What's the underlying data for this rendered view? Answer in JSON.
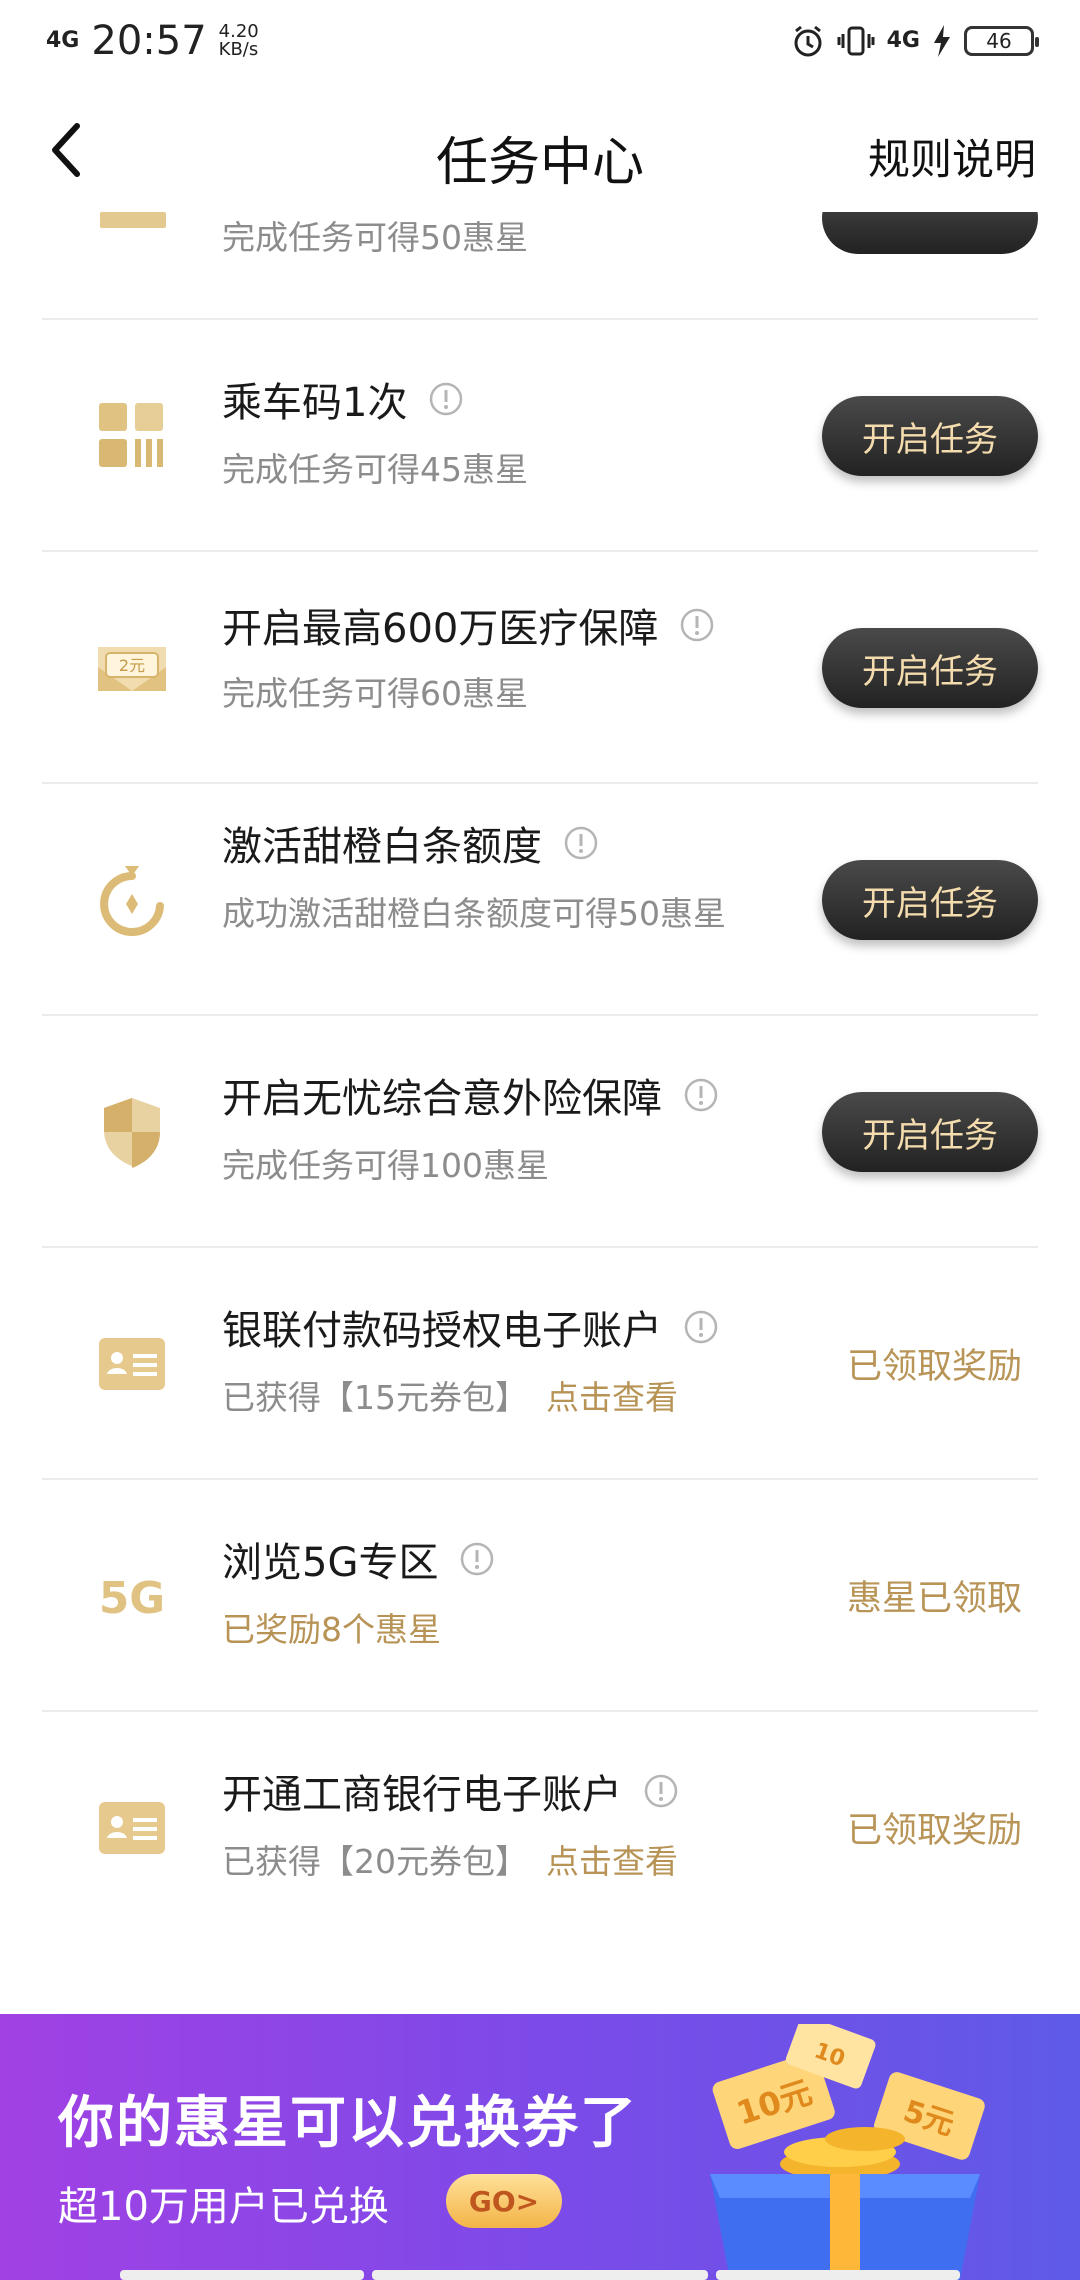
{
  "status_bar": {
    "network_left": "4G",
    "time": "20:57",
    "speed_value": "4.20",
    "speed_unit": "KB/s",
    "network_right": "4G",
    "battery": "46"
  },
  "header": {
    "title": "任务中心",
    "rules_label": "规则说明"
  },
  "partial_task": {
    "desc": "完成任务可得50惠星"
  },
  "tasks": [
    {
      "title": "乘车码1次",
      "desc": "完成任务可得45惠星",
      "action": "开启任务"
    },
    {
      "title": "开启最高600万医疗保障",
      "desc": "完成任务可得60惠星",
      "action": "开启任务"
    },
    {
      "title": "激活甜橙白条额度",
      "desc": "成功激活甜橙白条额度可得50惠星",
      "action": "开启任务"
    },
    {
      "title": "开启无忧综合意外险保障",
      "desc": "完成任务可得100惠星",
      "action": "开启任务"
    },
    {
      "title": "银联付款码授权电子账户",
      "desc": "已获得【15元券包】",
      "link": "点击查看",
      "status": "已领取奖励"
    },
    {
      "title": "浏览5G专区",
      "desc": "已奖励8个惠星",
      "status": "惠星已领取"
    },
    {
      "title": "开通工商银行电子账户",
      "desc": "已获得【20元券包】",
      "link": "点击查看",
      "status": "已领取奖励"
    }
  ],
  "icons": {
    "qr": "qr-code-icon",
    "coupon": "coupon-icon",
    "orange": "orange-icon",
    "shield": "shield-icon",
    "id_card": "id-card-icon",
    "fiveg": "5g-icon",
    "info": "info-icon",
    "back": "back-arrow-icon"
  },
  "colors": {
    "gold": "#b89457",
    "button_bg": "#2d2d2d",
    "button_text": "#f4dcae",
    "banner_start": "#a141e4",
    "banner_end": "#5f5ae8"
  },
  "banner": {
    "title": "你的惠星可以兑换券了",
    "subtitle": "超10万用户已兑换",
    "go_label": "GO>",
    "coupon_10": "10元",
    "coupon_10b": "10",
    "coupon_5": "5元"
  }
}
